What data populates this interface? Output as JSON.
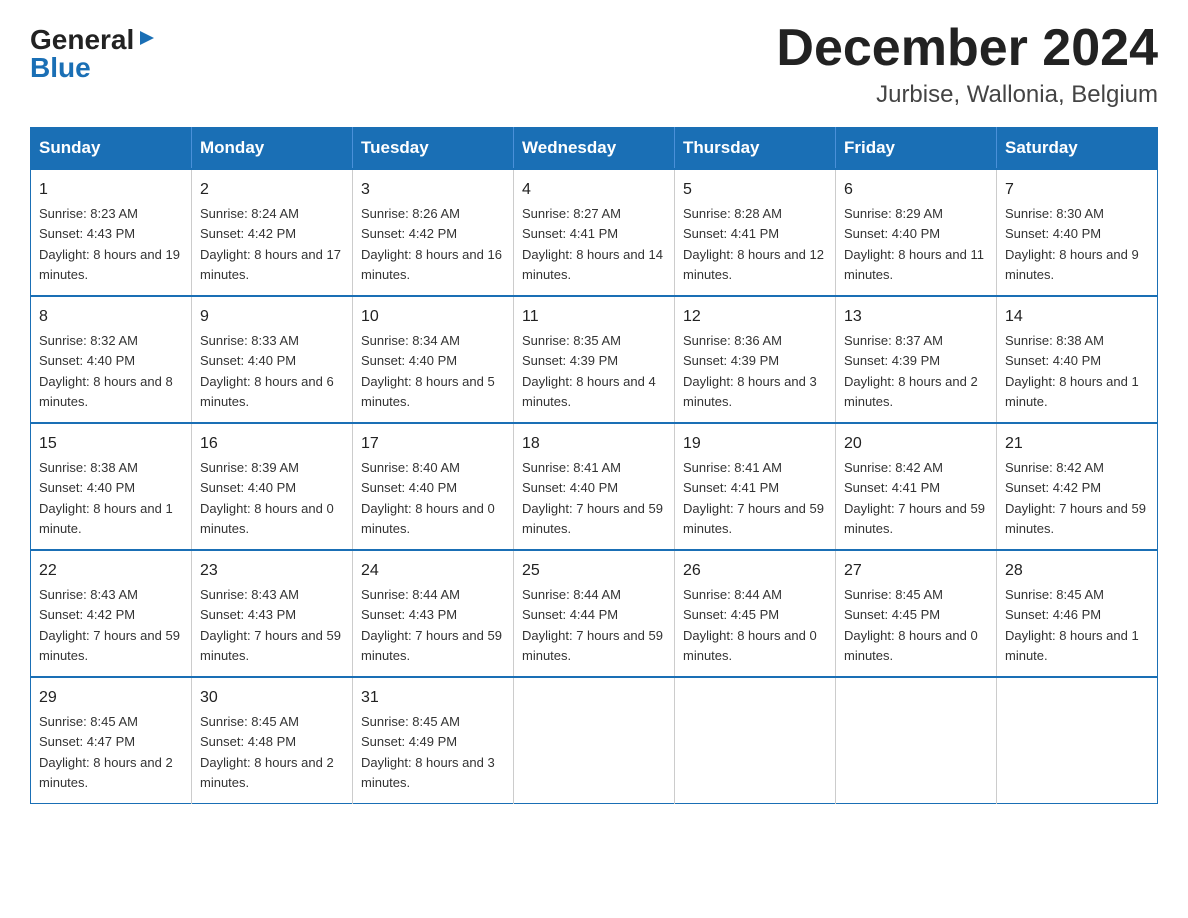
{
  "header": {
    "logo_general": "General",
    "logo_blue": "Blue",
    "month_title": "December 2024",
    "location": "Jurbise, Wallonia, Belgium"
  },
  "weekdays": [
    "Sunday",
    "Monday",
    "Tuesday",
    "Wednesday",
    "Thursday",
    "Friday",
    "Saturday"
  ],
  "weeks": [
    [
      {
        "day": "1",
        "sunrise": "8:23 AM",
        "sunset": "4:43 PM",
        "daylight": "8 hours and 19 minutes."
      },
      {
        "day": "2",
        "sunrise": "8:24 AM",
        "sunset": "4:42 PM",
        "daylight": "8 hours and 17 minutes."
      },
      {
        "day": "3",
        "sunrise": "8:26 AM",
        "sunset": "4:42 PM",
        "daylight": "8 hours and 16 minutes."
      },
      {
        "day": "4",
        "sunrise": "8:27 AM",
        "sunset": "4:41 PM",
        "daylight": "8 hours and 14 minutes."
      },
      {
        "day": "5",
        "sunrise": "8:28 AM",
        "sunset": "4:41 PM",
        "daylight": "8 hours and 12 minutes."
      },
      {
        "day": "6",
        "sunrise": "8:29 AM",
        "sunset": "4:40 PM",
        "daylight": "8 hours and 11 minutes."
      },
      {
        "day": "7",
        "sunrise": "8:30 AM",
        "sunset": "4:40 PM",
        "daylight": "8 hours and 9 minutes."
      }
    ],
    [
      {
        "day": "8",
        "sunrise": "8:32 AM",
        "sunset": "4:40 PM",
        "daylight": "8 hours and 8 minutes."
      },
      {
        "day": "9",
        "sunrise": "8:33 AM",
        "sunset": "4:40 PM",
        "daylight": "8 hours and 6 minutes."
      },
      {
        "day": "10",
        "sunrise": "8:34 AM",
        "sunset": "4:40 PM",
        "daylight": "8 hours and 5 minutes."
      },
      {
        "day": "11",
        "sunrise": "8:35 AM",
        "sunset": "4:39 PM",
        "daylight": "8 hours and 4 minutes."
      },
      {
        "day": "12",
        "sunrise": "8:36 AM",
        "sunset": "4:39 PM",
        "daylight": "8 hours and 3 minutes."
      },
      {
        "day": "13",
        "sunrise": "8:37 AM",
        "sunset": "4:39 PM",
        "daylight": "8 hours and 2 minutes."
      },
      {
        "day": "14",
        "sunrise": "8:38 AM",
        "sunset": "4:40 PM",
        "daylight": "8 hours and 1 minute."
      }
    ],
    [
      {
        "day": "15",
        "sunrise": "8:38 AM",
        "sunset": "4:40 PM",
        "daylight": "8 hours and 1 minute."
      },
      {
        "day": "16",
        "sunrise": "8:39 AM",
        "sunset": "4:40 PM",
        "daylight": "8 hours and 0 minutes."
      },
      {
        "day": "17",
        "sunrise": "8:40 AM",
        "sunset": "4:40 PM",
        "daylight": "8 hours and 0 minutes."
      },
      {
        "day": "18",
        "sunrise": "8:41 AM",
        "sunset": "4:40 PM",
        "daylight": "7 hours and 59 minutes."
      },
      {
        "day": "19",
        "sunrise": "8:41 AM",
        "sunset": "4:41 PM",
        "daylight": "7 hours and 59 minutes."
      },
      {
        "day": "20",
        "sunrise": "8:42 AM",
        "sunset": "4:41 PM",
        "daylight": "7 hours and 59 minutes."
      },
      {
        "day": "21",
        "sunrise": "8:42 AM",
        "sunset": "4:42 PM",
        "daylight": "7 hours and 59 minutes."
      }
    ],
    [
      {
        "day": "22",
        "sunrise": "8:43 AM",
        "sunset": "4:42 PM",
        "daylight": "7 hours and 59 minutes."
      },
      {
        "day": "23",
        "sunrise": "8:43 AM",
        "sunset": "4:43 PM",
        "daylight": "7 hours and 59 minutes."
      },
      {
        "day": "24",
        "sunrise": "8:44 AM",
        "sunset": "4:43 PM",
        "daylight": "7 hours and 59 minutes."
      },
      {
        "day": "25",
        "sunrise": "8:44 AM",
        "sunset": "4:44 PM",
        "daylight": "7 hours and 59 minutes."
      },
      {
        "day": "26",
        "sunrise": "8:44 AM",
        "sunset": "4:45 PM",
        "daylight": "8 hours and 0 minutes."
      },
      {
        "day": "27",
        "sunrise": "8:45 AM",
        "sunset": "4:45 PM",
        "daylight": "8 hours and 0 minutes."
      },
      {
        "day": "28",
        "sunrise": "8:45 AM",
        "sunset": "4:46 PM",
        "daylight": "8 hours and 1 minute."
      }
    ],
    [
      {
        "day": "29",
        "sunrise": "8:45 AM",
        "sunset": "4:47 PM",
        "daylight": "8 hours and 2 minutes."
      },
      {
        "day": "30",
        "sunrise": "8:45 AM",
        "sunset": "4:48 PM",
        "daylight": "8 hours and 2 minutes."
      },
      {
        "day": "31",
        "sunrise": "8:45 AM",
        "sunset": "4:49 PM",
        "daylight": "8 hours and 3 minutes."
      },
      null,
      null,
      null,
      null
    ]
  ]
}
